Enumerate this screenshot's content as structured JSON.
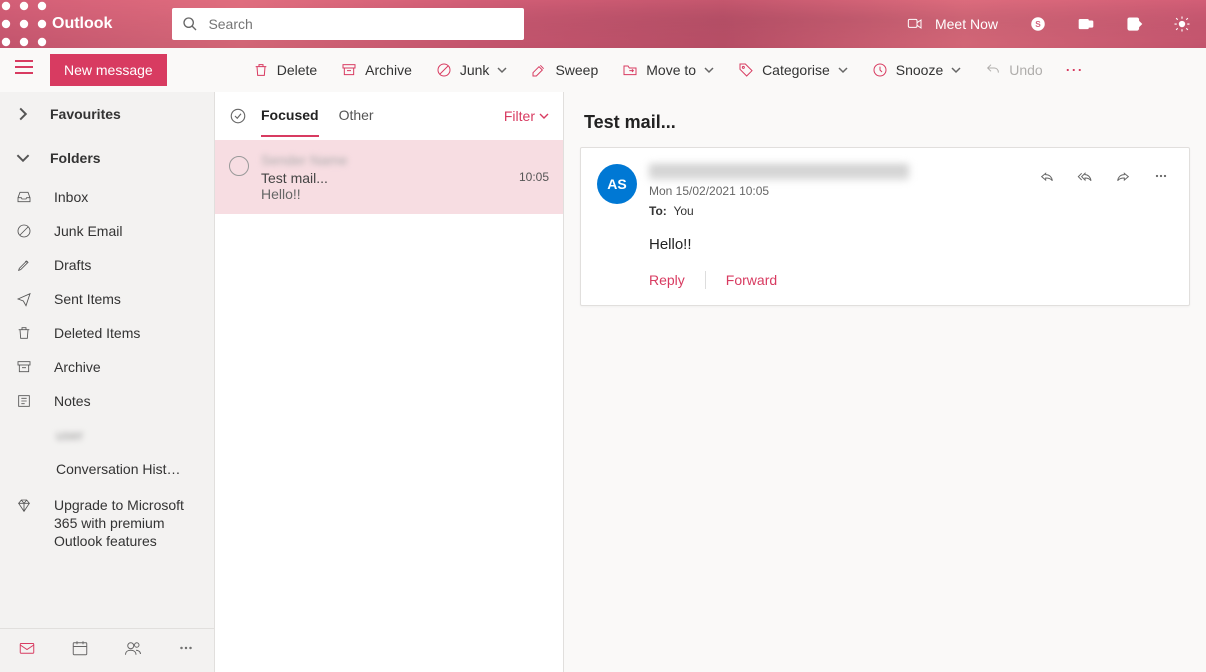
{
  "header": {
    "brand": "Outlook",
    "search_placeholder": "Search",
    "meet_now": "Meet Now"
  },
  "toolbar": {
    "new_message": "New message",
    "delete": "Delete",
    "archive": "Archive",
    "junk": "Junk",
    "sweep": "Sweep",
    "move_to": "Move to",
    "categorise": "Categorise",
    "snooze": "Snooze",
    "undo": "Undo"
  },
  "sidebar": {
    "favourites": "Favourites",
    "folders": "Folders",
    "items": {
      "inbox": "Inbox",
      "junk": "Junk Email",
      "drafts": "Drafts",
      "sent": "Sent Items",
      "deleted": "Deleted Items",
      "archive": "Archive",
      "notes": "Notes",
      "account": "user",
      "conversation": "Conversation Hist…"
    },
    "upgrade": "Upgrade to Microsoft 365 with premium Outlook features"
  },
  "msglist": {
    "tab_focused": "Focused",
    "tab_other": "Other",
    "filter": "Filter",
    "item": {
      "sender": "Sender Name",
      "subject": "Test mail...",
      "preview": "Hello!!",
      "time": "10:05"
    }
  },
  "reading": {
    "title": "Test mail...",
    "avatar_initials": "AS",
    "date": "Mon 15/02/2021 10:05",
    "to_label": "To:",
    "to_value": "You",
    "body": "Hello!!",
    "reply": "Reply",
    "forward": "Forward"
  }
}
